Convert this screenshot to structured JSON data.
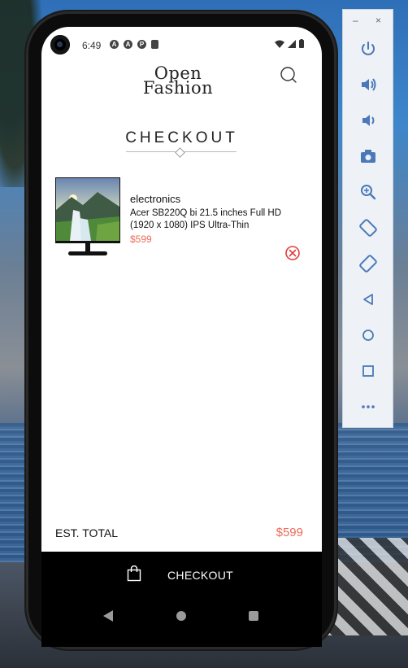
{
  "status_bar": {
    "time": "6:49",
    "icons": [
      "a-icon",
      "a-icon",
      "p-icon",
      "sd-card-icon"
    ],
    "right_icons": [
      "wifi-icon",
      "signal-icon",
      "battery-icon"
    ]
  },
  "app": {
    "logo_line1": "Open",
    "logo_line2": "Fashion",
    "page_title": "CHECKOUT"
  },
  "cart": {
    "items": [
      {
        "category": "electronics",
        "name": "Acer SB220Q bi 21.5 inches Full HD (1920 x 1080) IPS Ultra-Thin",
        "price": "$599",
        "image": "monitor-with-waterfall-landscape"
      }
    ]
  },
  "summary": {
    "total_label": "EST. TOTAL",
    "total_value": "$599"
  },
  "checkout_button": {
    "label": "CHECKOUT"
  },
  "colors": {
    "accent": "#ef6a5a",
    "bar": "#000000",
    "text": "#111111"
  },
  "emulator_panel": {
    "window_controls": [
      "minimize-icon",
      "close-icon"
    ],
    "tools": [
      "power-icon",
      "volume-up-icon",
      "volume-down-icon",
      "camera-icon",
      "zoom-icon",
      "rotate-left-icon",
      "rotate-right-icon",
      "back-icon",
      "home-icon",
      "overview-icon",
      "more-icon"
    ]
  }
}
